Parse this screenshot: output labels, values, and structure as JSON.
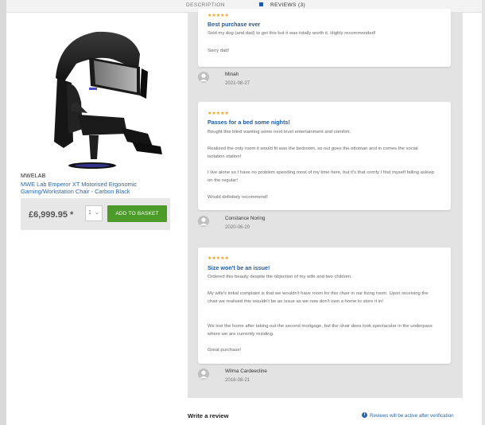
{
  "tabs": {
    "description": "DESCRIPTION",
    "reviews": "REVIEWS (3)"
  },
  "product": {
    "brand": "MWELAB",
    "name": "MWE Lab Emperor XT Motorised Ergonomic Gaming/Workstation Chair - Carbon Black",
    "price": "£6,999.95 *",
    "quantity": "1",
    "add_to_basket": "ADD TO BASKET",
    "image_icon": "gaming-chair-image"
  },
  "reviews": [
    {
      "stars": "★★★★★",
      "rating": 5,
      "title": "Best purchase ever",
      "paragraphs": [
        "Sold my dog (and dad) to get this but it was totally worth it. Highly recommended!",
        "Sorry dad!"
      ],
      "author": "Minah",
      "date": "2021-08-27"
    },
    {
      "stars": "★★★★★",
      "rating": 5,
      "title": "Passes for a bed some nights!",
      "paragraphs": [
        "Bought this blind wanting some next level entertainment and comfort.",
        "Realized the only room it would fit was the bedroom, so out goes the ottoman and in comes the social isolation station!",
        "I live alone so I have no problem spending most of my time here, but it's that comfy I find myself falling asleep on the regular!",
        "Would definitely recommend!"
      ],
      "author": "Constance Noring",
      "date": "2020-06-20"
    },
    {
      "stars": "★★★★★",
      "rating": 5,
      "title": "Size won't be an issue!",
      "paragraphs": [
        "Ordered this beauty despite the objection of my wife and two children.",
        "My wife's initial complaint is that we wouldn't have room for this chair in our living room. Upon receiving the chair we realised this wouldn't be an issue as we now don't own a home to store it in!",
        "We lost the home after taking out the second mortgage, but the chair does look spectacular in the underpass where we are currently residing.",
        "Great purchase!"
      ],
      "author": "Wilma Cardeecline",
      "date": "2018-08-21"
    }
  ],
  "footer": {
    "write_review": "Write a review",
    "verification_note": "Reviews will be active after verification"
  },
  "colors": {
    "accent": "#1f5aa6",
    "button": "#4c9a2a",
    "stars": "#f0a020"
  }
}
